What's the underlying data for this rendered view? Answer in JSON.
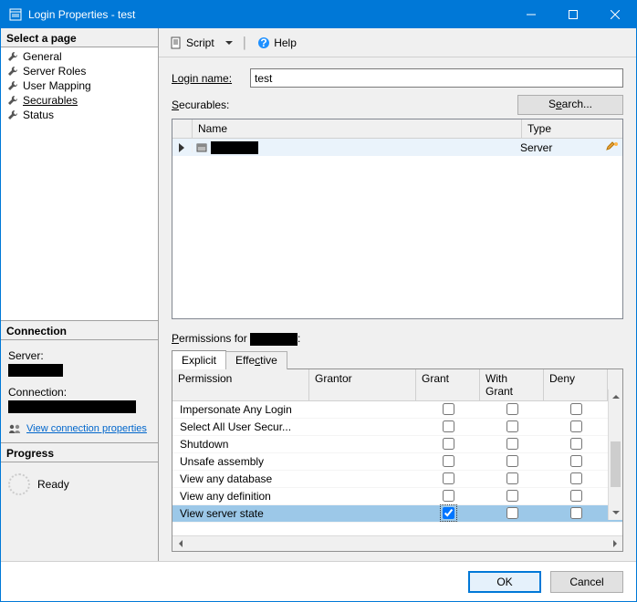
{
  "window": {
    "title": "Login Properties - test"
  },
  "sidebar": {
    "select_page_label": "Select a page",
    "pages": [
      {
        "label": "General"
      },
      {
        "label": "Server Roles"
      },
      {
        "label": "User Mapping"
      },
      {
        "label": "Securables",
        "selected": true
      },
      {
        "label": "Status"
      }
    ],
    "connection_label": "Connection",
    "server_label": "Server:",
    "connection_field_label": "Connection:",
    "view_conn_link": "View connection properties",
    "progress_label": "Progress",
    "progress_status": "Ready"
  },
  "toolbar": {
    "script": "Script",
    "help": "Help"
  },
  "form": {
    "login_name_label": "Login name:",
    "login_name_value": "test",
    "securables_label": "Securables:",
    "search_btn": "Search..."
  },
  "securables_grid": {
    "headers": {
      "name": "Name",
      "type": "Type"
    },
    "rows": [
      {
        "name_redacted": true,
        "type": "Server"
      }
    ]
  },
  "permissions_label_prefix": "Permissions for ",
  "tabs": {
    "explicit": "Explicit",
    "effective": "Effective"
  },
  "perm_grid": {
    "headers": {
      "permission": "Permission",
      "grantor": "Grantor",
      "grant": "Grant",
      "with_grant": "With Grant",
      "deny": "Deny"
    },
    "rows": [
      {
        "permission": "Impersonate Any Login",
        "grant": false,
        "with_grant": false,
        "deny": false
      },
      {
        "permission": "Select All User Secur...",
        "grant": false,
        "with_grant": false,
        "deny": false
      },
      {
        "permission": "Shutdown",
        "grant": false,
        "with_grant": false,
        "deny": false
      },
      {
        "permission": "Unsafe assembly",
        "grant": false,
        "with_grant": false,
        "deny": false
      },
      {
        "permission": "View any database",
        "grant": false,
        "with_grant": false,
        "deny": false
      },
      {
        "permission": "View any definition",
        "grant": false,
        "with_grant": false,
        "deny": false
      },
      {
        "permission": "View server state",
        "grant": true,
        "with_grant": false,
        "deny": false,
        "selected": true
      }
    ]
  },
  "buttons": {
    "ok": "OK",
    "cancel": "Cancel"
  }
}
